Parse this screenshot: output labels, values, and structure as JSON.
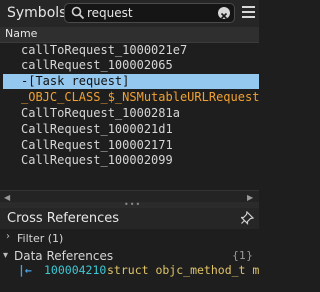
{
  "panel": {
    "title": "Symbols"
  },
  "search": {
    "value": "request",
    "placeholder": ""
  },
  "columns": {
    "name": "Name"
  },
  "symbols": [
    {
      "label": "callToRequest_1000021e7"
    },
    {
      "label": "callRequest_100002065"
    },
    {
      "label": "-[Task request]"
    },
    {
      "label": "_OBJC_CLASS_$_NSMutableURLRequest"
    },
    {
      "label": "CallToRequest_1000281a"
    },
    {
      "label": "CallRequest_1000021d1"
    },
    {
      "label": "CallRequest_100002171"
    },
    {
      "label": "CallRequest_100002099"
    }
  ],
  "cross_references": {
    "title": "Cross References",
    "filter": {
      "label": "Filter (1)"
    },
    "data_references": {
      "label": "Data References",
      "count": "{1}",
      "rows": [
        {
          "address": "100004210",
          "code": "struct objc_method_t m"
        }
      ]
    }
  },
  "colors": {
    "selection": "#95c8ef",
    "highlight_symbol": "#f0a132",
    "address": "#3fc7d4",
    "code": "#e0c46a"
  }
}
